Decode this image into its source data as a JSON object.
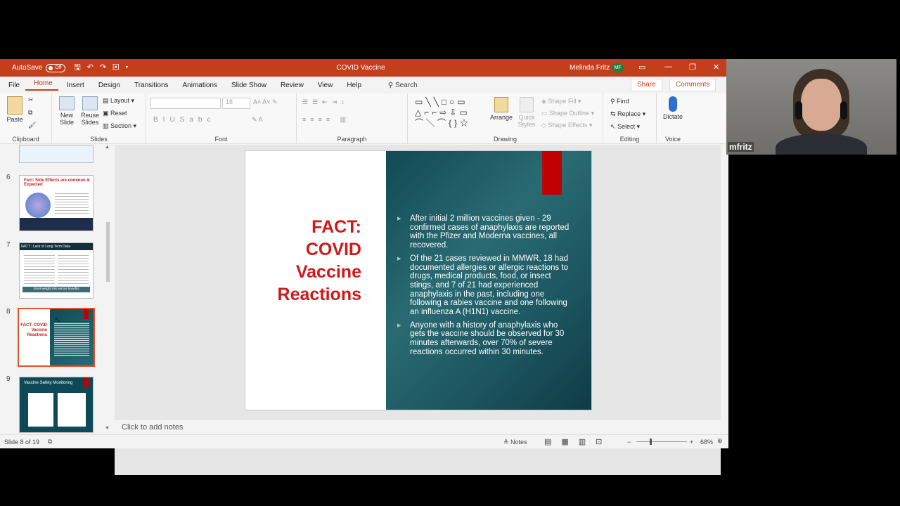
{
  "window": {
    "autosave_label": "AutoSave",
    "autosave_state": "Off",
    "title": "COVID Vaccine",
    "user_name": "Melinda Fritz",
    "user_initials": "MF"
  },
  "menu": {
    "items": [
      "File",
      "Home",
      "Insert",
      "Design",
      "Transitions",
      "Animations",
      "Slide Show",
      "Review",
      "View",
      "Help"
    ],
    "search": "Search",
    "share": "Share",
    "comments": "Comments"
  },
  "ribbon": {
    "clipboard": {
      "label": "Clipboard",
      "paste": "Paste"
    },
    "slides": {
      "label": "Slides",
      "new_slide": "New Slide",
      "reuse_slides": "Reuse Slides",
      "layout": "Layout",
      "reset": "Reset",
      "section": "Section"
    },
    "font": {
      "label": "Font",
      "size": "18"
    },
    "paragraph": {
      "label": "Paragraph"
    },
    "drawing": {
      "label": "Drawing",
      "arrange": "Arrange",
      "quick_styles": "Quick Styles",
      "shape_fill": "Shape Fill",
      "shape_outline": "Shape Outline",
      "shape_effects": "Shape Effects"
    },
    "editing": {
      "label": "Editing",
      "find": "Find",
      "replace": "Replace",
      "select": "Select"
    },
    "voice": {
      "label": "Voice",
      "dictate": "Dictate"
    }
  },
  "thumbnails": [
    {
      "num": "6",
      "title": "Fact: Side Effects are common & Expected"
    },
    {
      "num": "7",
      "title": "FACT : Lack of Long Term Data",
      "footer": "Short-weight risk versus benefits"
    },
    {
      "num": "8",
      "title": "FACT: COVID Vaccine Reactions"
    },
    {
      "num": "9",
      "title": "Vaccine Safety Monitoring"
    }
  ],
  "slide": {
    "title_lines": [
      "FACT:",
      "COVID",
      "Vaccine",
      "Reactions"
    ],
    "bullets": [
      "After initial 2 million vaccines given - 29 confirmed cases of anaphylaxis are reported with the Pfizer and Moderna vaccines, all recovered.",
      "Of the 21 cases reviewed in MMWR, 18 had documented allergies or allergic reactions to drugs, medical products, food, or insect stings, and 7 of 21 had experienced anaphylaxis in the past, including one following a rabies vaccine and one following an influenza A (H1N1) vaccine.",
      "Anyone with a history of anaphylaxis who gets the vaccine should be observed for 30 minutes afterwards, over 70% of severe reactions occurred within 30 minutes."
    ]
  },
  "notes_placeholder": "Click to add notes",
  "status": {
    "slide_count": "Slide 8 of 19",
    "notes": "Notes",
    "zoom": "68%"
  },
  "video": {
    "participant": "mfritz"
  }
}
